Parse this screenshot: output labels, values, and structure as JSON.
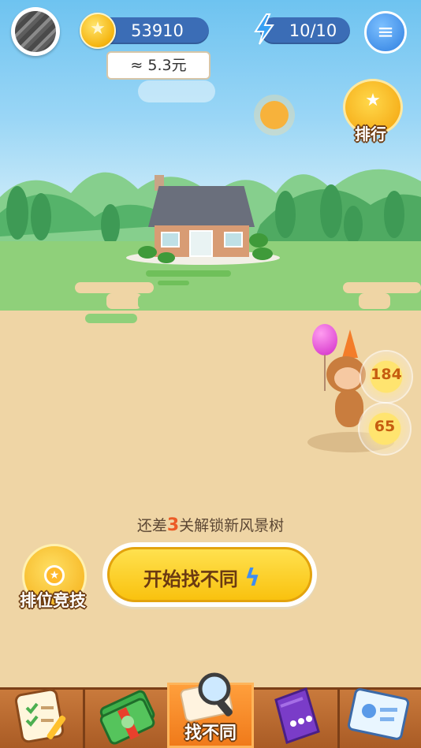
{
  "header": {
    "coins": "53910",
    "coin_value": "≈ 5.3元",
    "energy": "10/10"
  },
  "side": {
    "ranking_label": "排行"
  },
  "progress": {
    "prefix": "还差",
    "levels_remaining": "3",
    "suffix": "关解锁新风景树"
  },
  "actions": {
    "ranked_competition_label": "排位竞技",
    "start_button_label": "开始找不同"
  },
  "bubbles": [
    "184",
    "65"
  ],
  "nav": {
    "items": [
      {
        "icon": "checklist-icon",
        "label": ""
      },
      {
        "icon": "cash-icon",
        "label": ""
      },
      {
        "icon": "magnifier-icon",
        "label": "找不同",
        "active": true
      },
      {
        "icon": "bag-icon",
        "label": ""
      },
      {
        "icon": "profile-card-icon",
        "label": ""
      }
    ]
  },
  "colors": {
    "sky": "#6ec3f0",
    "grass": "#8fd07a",
    "ground": "#efd5a5",
    "accent_blue": "#3b6db6",
    "button_yellow": "#fbd22f",
    "nav_brown": "#b9682f"
  }
}
